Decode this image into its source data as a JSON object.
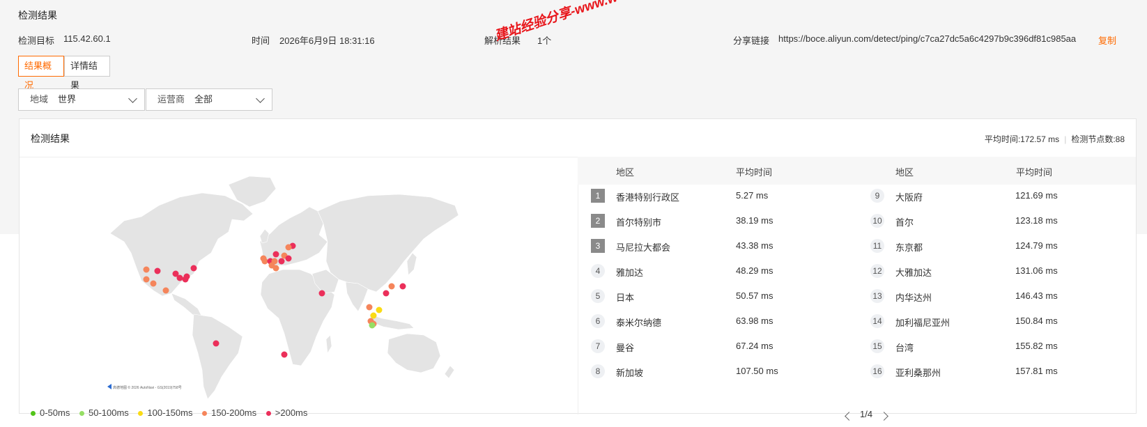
{
  "page": {
    "title": "检测结果"
  },
  "info": {
    "target_label": "检测目标",
    "target_value": "115.42.60.1",
    "time_label": "时间",
    "time_value": "2026年6月9日 18:31:16",
    "resolve_label": "解析结果",
    "resolve_value": "1个",
    "share_label": "分享链接",
    "share_value": "https://boce.aliyun.com/detect/ping/c7ca27dc5a6c4297b9c396df81c985aa",
    "copy_label": "复制"
  },
  "tabs": [
    {
      "label": "结果概况",
      "active": true
    },
    {
      "label": "详情结果",
      "active": false
    }
  ],
  "filters": {
    "region_key": "地域",
    "region_value": "世界",
    "isp_key": "运营商",
    "isp_value": "全部"
  },
  "card": {
    "title": "检测结果",
    "avg_time": "平均时间:172.57 ms",
    "node_count": "检测节点数:88"
  },
  "map": {
    "attribution": "高德地图 © 2026 AutoNavi - GS(2019)758号",
    "legend": [
      {
        "label": "0-50ms",
        "color": "#52c41a"
      },
      {
        "label": "50-100ms",
        "color": "#95de64"
      },
      {
        "label": "100-150ms",
        "color": "#fadb14"
      },
      {
        "label": "150-200ms",
        "color": "#f5855b"
      },
      {
        "label": ">200ms",
        "color": "#eb2f5a"
      }
    ]
  },
  "table": {
    "col_region": "地区",
    "col_time": "平均时间",
    "left_rows": [
      {
        "rank": "1",
        "region": "香港特别行政区",
        "time": "5.27 ms"
      },
      {
        "rank": "2",
        "region": "首尔特别市",
        "time": "38.19 ms"
      },
      {
        "rank": "3",
        "region": "马尼拉大都会",
        "time": "43.38 ms"
      },
      {
        "rank": "4",
        "region": "雅加达",
        "time": "48.29 ms"
      },
      {
        "rank": "5",
        "region": "日本",
        "time": "50.57 ms"
      },
      {
        "rank": "6",
        "region": "泰米尔纳德",
        "time": "63.98 ms"
      },
      {
        "rank": "7",
        "region": "曼谷",
        "time": "67.24 ms"
      },
      {
        "rank": "8",
        "region": "新加坡",
        "time": "107.50 ms"
      }
    ],
    "right_rows": [
      {
        "rank": "9",
        "region": "大阪府",
        "time": "121.69 ms"
      },
      {
        "rank": "10",
        "region": "首尔",
        "time": "123.18 ms"
      },
      {
        "rank": "11",
        "region": "东京都",
        "time": "124.79 ms"
      },
      {
        "rank": "12",
        "region": "大雅加达",
        "time": "131.06 ms"
      },
      {
        "rank": "13",
        "region": "内华达州",
        "time": "146.43 ms"
      },
      {
        "rank": "14",
        "region": "加利福尼亚州",
        "time": "150.84 ms"
      },
      {
        "rank": "15",
        "region": "台湾",
        "time": "155.82 ms"
      },
      {
        "rank": "16",
        "region": "亚利桑那州",
        "time": "157.81 ms"
      }
    ],
    "pager": "1/4"
  },
  "watermark": "建站经验分享-www.w"
}
